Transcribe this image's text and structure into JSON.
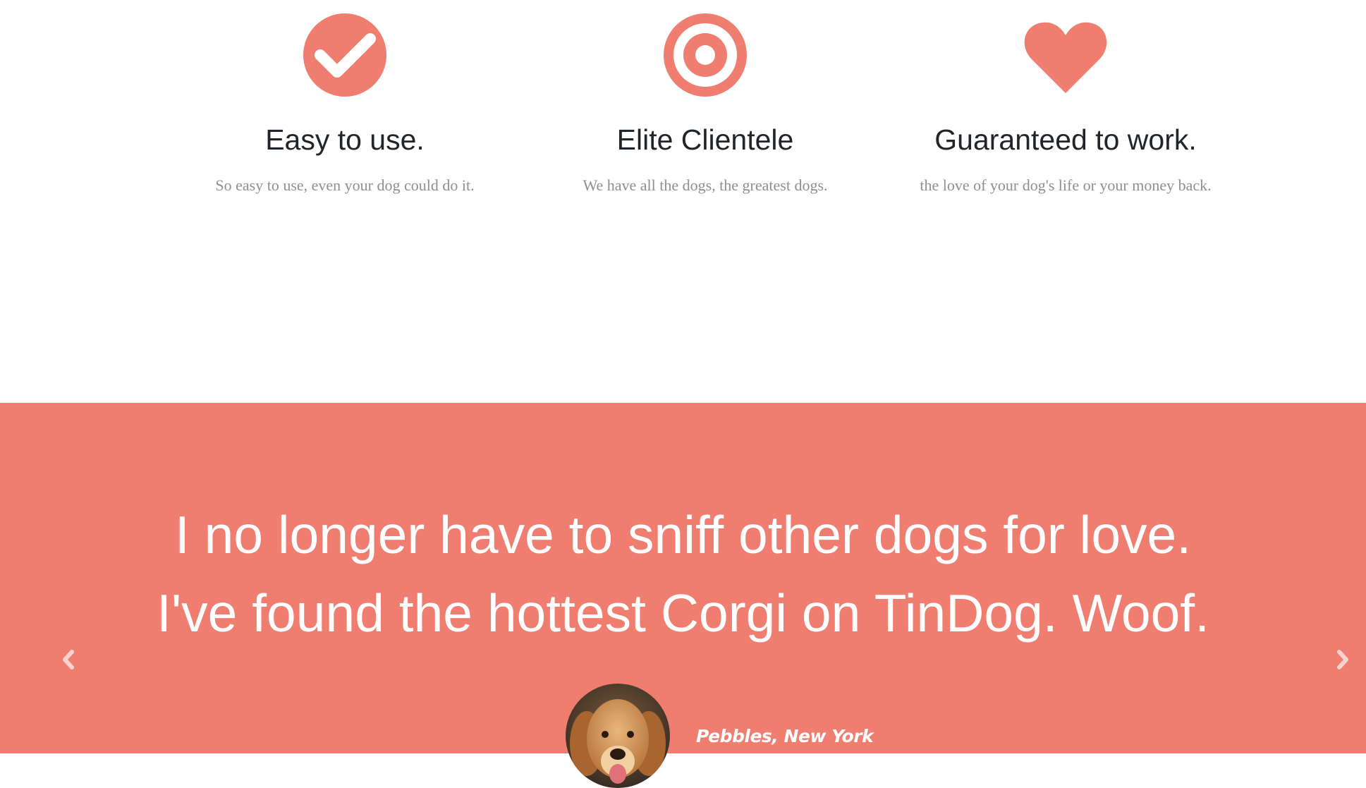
{
  "colors": {
    "accent": "#ef7e71",
    "heading": "#212529",
    "muted_text": "#8f8f8f",
    "white": "#ffffff"
  },
  "features": [
    {
      "icon": "check-circle-icon",
      "title": "Easy to use.",
      "text": "So easy to use, even your dog could do it."
    },
    {
      "icon": "bullseye-icon",
      "title": "Elite Clientele",
      "text": "We have all the dogs, the greatest dogs."
    },
    {
      "icon": "heart-icon",
      "title": "Guaranteed to work.",
      "text": "the love of your dog's life or your money back."
    }
  ],
  "testimonial": {
    "quote_line_1": "I no longer have to sniff other dogs for love.",
    "quote_line_2": "I've found the hottest Corgi on TinDog. Woof.",
    "author": "Pebbles, New York",
    "avatar": "golden-retriever-photo",
    "prev_icon": "chevron-left-icon",
    "next_icon": "chevron-right-icon"
  }
}
